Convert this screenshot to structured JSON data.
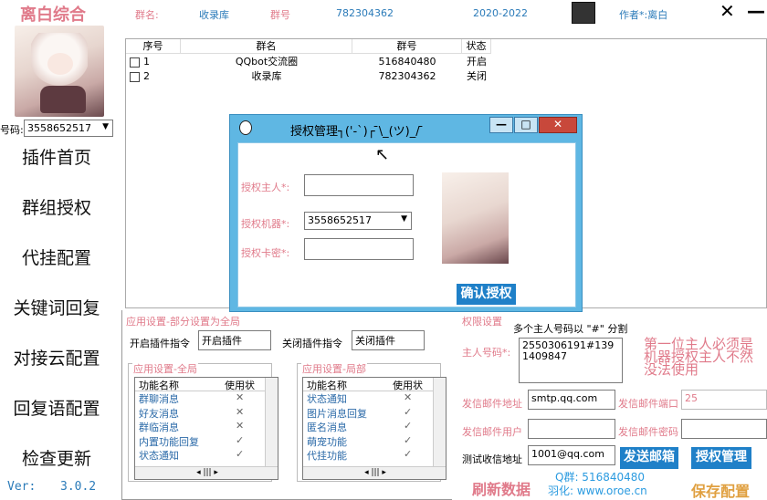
{
  "app": {
    "title": "离白综合",
    "version_label": "Ver:",
    "version": "3.0.2"
  },
  "sidebar": {
    "qq_label": "号码:",
    "qq_value": "3558652517",
    "items": [
      {
        "label": "插件首页"
      },
      {
        "label": "群组授权"
      },
      {
        "label": "代挂配置"
      },
      {
        "label": "关键词回复"
      },
      {
        "label": "对接云配置"
      },
      {
        "label": "回复语配置"
      },
      {
        "label": "检查更新"
      }
    ]
  },
  "top": {
    "group_name_label": "群名:",
    "group_name": "收录库",
    "group_no_label": "群号",
    "group_no": "782304362",
    "date_range": "2020-2022",
    "author": "作者*:离白",
    "close": "✕",
    "minimize": "—"
  },
  "table": {
    "headers": [
      "序号",
      "群名",
      "群号",
      "状态"
    ],
    "rows": [
      {
        "no": "1",
        "name": "QQbot交流圈",
        "id": "516840480",
        "status": "开启"
      },
      {
        "no": "2",
        "name": "收录库",
        "id": "782304362",
        "status": "关闭"
      }
    ]
  },
  "app_settings": {
    "title": "应用设置-部分设置为全局",
    "enable_label": "开启插件指令",
    "enable_value": "开启插件",
    "disable_label": "关闭插件指令",
    "disable_value": "关闭插件",
    "global": {
      "title": "应用设置-全局",
      "headers": [
        "功能名称",
        "使用状"
      ],
      "rows": [
        {
          "name": "群聊消息",
          "state": "✕"
        },
        {
          "name": "好友消息",
          "state": "✕"
        },
        {
          "name": "群临消息",
          "state": "✕"
        },
        {
          "name": "内置功能回复",
          "state": "✓"
        },
        {
          "name": "状态通知",
          "state": "✓"
        }
      ]
    },
    "local": {
      "title": "应用设置-局部",
      "headers": [
        "功能名称",
        "使用状"
      ],
      "rows": [
        {
          "name": "状态通知",
          "state": "✕"
        },
        {
          "name": "图片消息回复",
          "state": "✓"
        },
        {
          "name": "匿名消息",
          "state": "✓"
        },
        {
          "name": "萌宠功能",
          "state": "✓"
        },
        {
          "name": "代挂功能",
          "state": "✓"
        }
      ]
    }
  },
  "permissions": {
    "title": "权限设置",
    "hint": "多个主人号码以 \"#\" 分割",
    "owner_label": "主人号码*:",
    "owner_value": "2550306191#1391409847",
    "note": "第一位主人必须是机器授权主人不然没法使用",
    "smtp_label": "发信邮件地址",
    "smtp_value": "smtp.qq.com",
    "port_label": "发信邮件端口",
    "port_value": "25",
    "user_label": "发信邮件用户",
    "user_value": "",
    "pass_label": "发信邮件密码",
    "pass_value": "",
    "test_label": "测试收信地址",
    "test_value": "1001@qq.com",
    "send_button": "发送邮箱",
    "auth_button": "授权管理",
    "refresh": "刷新数据",
    "save": "保存配置",
    "qq_group": "Q群: 516840480",
    "site": "羽化: www.oroe.cn"
  },
  "dialog": {
    "title": "授权管理┐('-`)┌ ̄\\_(ツ)_/ ̄",
    "owner_label": "授权主人*:",
    "owner_value": "",
    "robot_label": "授权机器*:",
    "robot_value": "3558652517",
    "card_label": "授权卡密*:",
    "card_value": "",
    "confirm": "确认授权",
    "min": "—",
    "max": "□",
    "close": "✕"
  },
  "colors": {
    "accent_pink": "#e07a8a",
    "accent_blue": "#1f80c8",
    "dialog_frame": "#5fb7e3"
  }
}
